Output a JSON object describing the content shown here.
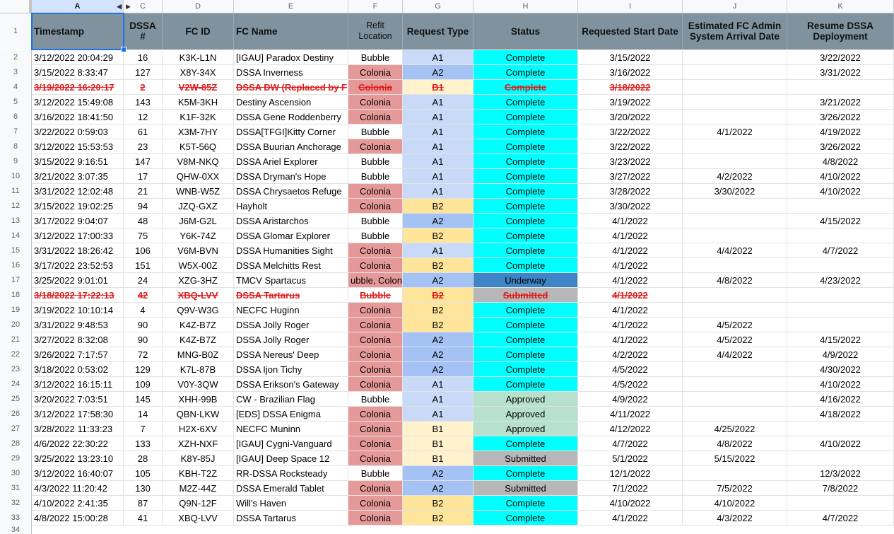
{
  "column_letters": [
    "A",
    "",
    "C",
    "D",
    "E",
    "F",
    "G",
    "H",
    "I",
    "J",
    "K"
  ],
  "header_row_number": "1",
  "headers": {
    "timestamp": "Timestamp",
    "dssa": "DSSA #",
    "fcid": "FC ID",
    "fcname": "FC Name",
    "refit": "Refit Location",
    "reqtype": "Request Type",
    "status": "Status",
    "reqstart": "Requested Start Date",
    "estarrival": "Estimated FC Admin System Arrival Date",
    "resume": "Resume DSSA Deployment"
  },
  "rows": [
    {
      "n": "2",
      "ts": "3/12/2022 20:04:29",
      "dssa": "16",
      "fcid": "K3K-L1N",
      "name": "[IGAU] Paradox Destiny",
      "refit": "Bubble",
      "type": "A1",
      "status": "Complete",
      "start": "3/15/2022",
      "arrival": "",
      "resume": "3/22/2022",
      "struck": false
    },
    {
      "n": "3",
      "ts": "3/15/2022 8:33:47",
      "dssa": "127",
      "fcid": "X8Y-34X",
      "name": "DSSA Inverness",
      "refit": "Colonia",
      "type": "A2",
      "status": "Complete",
      "start": "3/16/2022",
      "arrival": "",
      "resume": "3/31/2022",
      "struck": false
    },
    {
      "n": "4",
      "ts": "3/19/2022 16:20:17",
      "dssa": "2",
      "fcid": "V2W-85Z",
      "name": "DSSA DW (Replaced by F",
      "refit": "Colonia",
      "type": "B1",
      "status": "Complete",
      "start": "3/18/2022",
      "arrival": "",
      "resume": "",
      "struck": true
    },
    {
      "n": "5",
      "ts": "3/12/2022 15:49:08",
      "dssa": "143",
      "fcid": "K5M-3KH",
      "name": "Destiny Ascension",
      "refit": "Colonia",
      "type": "A1",
      "status": "Complete",
      "start": "3/19/2022",
      "arrival": "",
      "resume": "3/21/2022",
      "struck": false
    },
    {
      "n": "6",
      "ts": "3/16/2022 18:41:50",
      "dssa": "12",
      "fcid": "K1F-32K",
      "name": "DSSA Gene Roddenberry",
      "refit": "Colonia",
      "type": "A1",
      "status": "Complete",
      "start": "3/20/2022",
      "arrival": "",
      "resume": "3/26/2022",
      "struck": false
    },
    {
      "n": "7",
      "ts": "3/22/2022 0:59:03",
      "dssa": "61",
      "fcid": "X3M-7HY",
      "name": "DSSA[TFGI]Kitty Corner",
      "refit": "Bubble",
      "type": "A1",
      "status": "Complete",
      "start": "3/22/2022",
      "arrival": "4/1/2022",
      "resume": "4/19/2022",
      "struck": false
    },
    {
      "n": "8",
      "ts": "3/12/2022 15:53:53",
      "dssa": "23",
      "fcid": "K5T-56Q",
      "name": "DSSA Buurian Anchorage",
      "refit": "Colonia",
      "type": "A1",
      "status": "Complete",
      "start": "3/22/2022",
      "arrival": "",
      "resume": "3/26/2022",
      "struck": false
    },
    {
      "n": "9",
      "ts": "3/15/2022 9:16:51",
      "dssa": "147",
      "fcid": "V8M-NKQ",
      "name": "DSSA Ariel Explorer",
      "refit": "Bubble",
      "type": "A1",
      "status": "Complete",
      "start": "3/23/2022",
      "arrival": "",
      "resume": "4/8/2022",
      "struck": false
    },
    {
      "n": "10",
      "ts": "3/21/2022 3:07:35",
      "dssa": "17",
      "fcid": "QHW-0XX",
      "name": "DSSA Dryman's Hope",
      "refit": "Bubble",
      "type": "A1",
      "status": "Complete",
      "start": "3/27/2022",
      "arrival": "4/2/2022",
      "resume": "4/10/2022",
      "struck": false
    },
    {
      "n": "11",
      "ts": "3/31/2022 12:02:48",
      "dssa": "21",
      "fcid": "WNB-W5Z",
      "name": "DSSA Chrysaetos Refuge",
      "refit": "Colonia",
      "type": "A1",
      "status": "Complete",
      "start": "3/28/2022",
      "arrival": "3/30/2022",
      "resume": "4/10/2022",
      "struck": false
    },
    {
      "n": "12",
      "ts": "3/15/2022 19:02:25",
      "dssa": "94",
      "fcid": "JZQ-GXZ",
      "name": "Hayholt",
      "refit": "Colonia",
      "type": "B2",
      "status": "Complete",
      "start": "3/30/2022",
      "arrival": "",
      "resume": "",
      "struck": false
    },
    {
      "n": "13",
      "ts": "3/17/2022 9:04:07",
      "dssa": "48",
      "fcid": "J6M-G2L",
      "name": "DSSA Aristarchos",
      "refit": "Bubble",
      "type": "A2",
      "status": "Complete",
      "start": "4/1/2022",
      "arrival": "",
      "resume": "4/15/2022",
      "struck": false
    },
    {
      "n": "14",
      "ts": "3/12/2022 17:00:33",
      "dssa": "75",
      "fcid": "Y6K-74Z",
      "name": "DSSA Glomar Explorer",
      "refit": "Bubble",
      "type": "B2",
      "status": "Complete",
      "start": "4/1/2022",
      "arrival": "",
      "resume": "",
      "struck": false
    },
    {
      "n": "15",
      "ts": "3/31/2022 18:26:42",
      "dssa": "106",
      "fcid": "V6M-BVN",
      "name": "DSSA Humanities Sight",
      "refit": "Colonia",
      "type": "A1",
      "status": "Complete",
      "start": "4/1/2022",
      "arrival": "4/4/2022",
      "resume": "4/7/2022",
      "struck": false
    },
    {
      "n": "16",
      "ts": "3/17/2022 23:52:53",
      "dssa": "151",
      "fcid": "W5X-00Z",
      "name": "DSSA Melchitts Rest",
      "refit": "Colonia",
      "type": "B2",
      "status": "Complete",
      "start": "4/1/2022",
      "arrival": "",
      "resume": "",
      "struck": false
    },
    {
      "n": "17",
      "ts": "3/25/2022 9:01:01",
      "dssa": "24",
      "fcid": "XZG-3HZ",
      "name": "TMCV Spartacus",
      "refit": "ubble, Colon",
      "type": "A2",
      "status": "Underway",
      "start": "4/1/2022",
      "arrival": "4/8/2022",
      "resume": "4/23/2022",
      "struck": false
    },
    {
      "n": "18",
      "ts": "3/18/2022 17:22:13",
      "dssa": "42",
      "fcid": "XBQ-LVV",
      "name": "DSSA Tartarus",
      "refit": "Bubble",
      "type": "B2",
      "status": "Submitted",
      "start": "4/1/2022",
      "arrival": "",
      "resume": "",
      "struck": true
    },
    {
      "n": "19",
      "ts": "3/19/2022 10:10:14",
      "dssa": "4",
      "fcid": "Q9V-W3G",
      "name": "NECFC Huginn",
      "refit": "Colonia",
      "type": "B2",
      "status": "Complete",
      "start": "4/1/2022",
      "arrival": "",
      "resume": "",
      "struck": false
    },
    {
      "n": "20",
      "ts": "3/31/2022 9:48:53",
      "dssa": "90",
      "fcid": "K4Z-B7Z",
      "name": "DSSA Jolly Roger",
      "refit": "Colonia",
      "type": "B2",
      "status": "Complete",
      "start": "4/1/2022",
      "arrival": "4/5/2022",
      "resume": "",
      "struck": false
    },
    {
      "n": "21",
      "ts": "3/27/2022 8:32:08",
      "dssa": "90",
      "fcid": "K4Z-B7Z",
      "name": "DSSA Jolly Roger",
      "refit": "Colonia",
      "type": "A2",
      "status": "Complete",
      "start": "4/1/2022",
      "arrival": "4/5/2022",
      "resume": "4/15/2022",
      "struck": false
    },
    {
      "n": "22",
      "ts": "3/26/2022 7:17:57",
      "dssa": "72",
      "fcid": "MNG-B0Z",
      "name": "DSSA Nereus' Deep",
      "refit": "Colonia",
      "type": "A2",
      "status": "Complete",
      "start": "4/2/2022",
      "arrival": "4/4/2022",
      "resume": "4/9/2022",
      "struck": false
    },
    {
      "n": "23",
      "ts": "3/18/2022 0:53:02",
      "dssa": "129",
      "fcid": "K7L-87B",
      "name": "DSSA Ijon Tichy",
      "refit": "Colonia",
      "type": "A2",
      "status": "Complete",
      "start": "4/5/2022",
      "arrival": "",
      "resume": "4/30/2022",
      "struck": false
    },
    {
      "n": "24",
      "ts": "3/12/2022 16:15:11",
      "dssa": "109",
      "fcid": "V0Y-3QW",
      "name": "DSSA Erikson's Gateway",
      "refit": "Colonia",
      "type": "A1",
      "status": "Complete",
      "start": "4/5/2022",
      "arrival": "",
      "resume": "4/10/2022",
      "struck": false
    },
    {
      "n": "25",
      "ts": "3/20/2022 7:03:51",
      "dssa": "145",
      "fcid": "XHH-99B",
      "name": "CW - Brazilian Flag",
      "refit": "Bubble",
      "type": "A1",
      "status": "Approved",
      "start": "4/9/2022",
      "arrival": "",
      "resume": "4/16/2022",
      "struck": false
    },
    {
      "n": "26",
      "ts": "3/12/2022 17:58:30",
      "dssa": "14",
      "fcid": "QBN-LKW",
      "name": "[EDS] DSSA Enigma",
      "refit": "Colonia",
      "type": "A1",
      "status": "Approved",
      "start": "4/11/2022",
      "arrival": "",
      "resume": "4/18/2022",
      "struck": false
    },
    {
      "n": "27",
      "ts": "3/28/2022 11:33:23",
      "dssa": "7",
      "fcid": "H2X-6XV",
      "name": "NECFC Muninn",
      "refit": "Colonia",
      "type": "B1",
      "status": "Approved",
      "start": "4/12/2022",
      "arrival": "4/25/2022",
      "resume": "",
      "struck": false
    },
    {
      "n": "28",
      "ts": "4/6/2022 22:30:22",
      "dssa": "133",
      "fcid": "XZH-NXF",
      "name": "[IGAU] Cygni-Vanguard",
      "refit": "Colonia",
      "type": "B1",
      "status": "Complete",
      "start": "4/7/2022",
      "arrival": "4/8/2022",
      "resume": "4/10/2022",
      "struck": false
    },
    {
      "n": "29",
      "ts": "3/25/2022 13:23:10",
      "dssa": "28",
      "fcid": "K8Y-85J",
      "name": "[IGAU] Deep Space 12",
      "refit": "Colonia",
      "type": "B1",
      "status": "Submitted",
      "start": "5/1/2022",
      "arrival": "5/15/2022",
      "resume": "",
      "struck": false
    },
    {
      "n": "30",
      "ts": "3/12/2022 16:40:07",
      "dssa": "105",
      "fcid": "KBH-T2Z",
      "name": "RR-DSSA Rocksteady",
      "refit": "Bubble",
      "type": "A2",
      "status": "Complete",
      "start": "12/1/2022",
      "arrival": "",
      "resume": "12/3/2022",
      "struck": false
    },
    {
      "n": "31",
      "ts": "4/3/2022 11:20:42",
      "dssa": "130",
      "fcid": "M2Z-44Z",
      "name": "DSSA Emerald Tablet",
      "refit": "Colonia",
      "type": "A2",
      "status": "Submitted",
      "start": "7/1/2022",
      "arrival": "7/5/2022",
      "resume": "7/8/2022",
      "struck": false
    },
    {
      "n": "32",
      "ts": "4/10/2022 2:41:35",
      "dssa": "87",
      "fcid": "Q9N-12F",
      "name": "Will's Haven",
      "refit": "Colonia",
      "type": "B2",
      "status": "Complete",
      "start": "4/10/2022",
      "arrival": "4/10/2022",
      "resume": "",
      "struck": false
    },
    {
      "n": "33",
      "ts": "4/8/2022 15:00:28",
      "dssa": "41",
      "fcid": "XBQ-LVV",
      "name": "DSSA Tartarus",
      "refit": "Colonia",
      "type": "B2",
      "status": "Complete",
      "start": "4/1/2022",
      "arrival": "4/3/2022",
      "resume": "4/7/2022",
      "struck": false
    }
  ],
  "trailing_row_number": "34"
}
